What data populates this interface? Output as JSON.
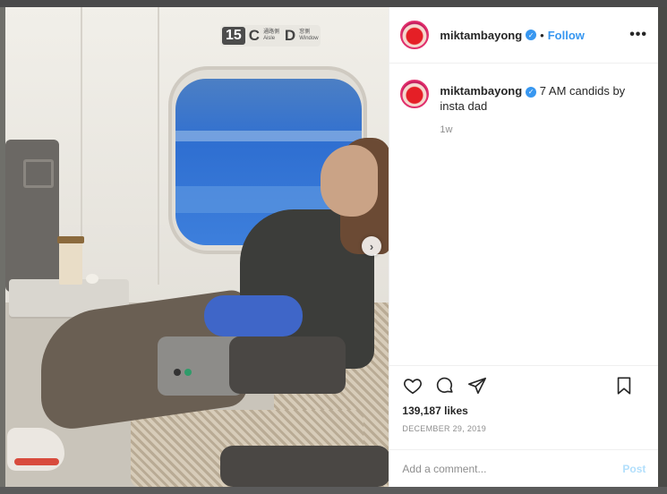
{
  "post": {
    "username": "miktambayong",
    "follow_label": "Follow",
    "more_label": "•••",
    "caption_text": "7 AM candids by insta dad",
    "time_ago": "1w",
    "likes": "139,187 likes",
    "date": "DECEMBER 29, 2019",
    "comment_placeholder": "Add a comment...",
    "post_label": "Post",
    "separator": "•",
    "verified_glyph": "✓"
  },
  "photo": {
    "seat_number": "15",
    "seat_left_letter": "C",
    "seat_left_text": "通路側 Aisle",
    "seat_right_letter": "D",
    "seat_right_text": "窓側 Window",
    "next_glyph": "›"
  },
  "icons": {
    "like": "heart-icon",
    "comment": "comment-icon",
    "share": "share-icon",
    "save": "bookmark-icon",
    "next": "chevron-right-icon",
    "verified": "verified-badge-icon"
  },
  "colors": {
    "link_blue": "#3897f0",
    "post_disabled": "#b2dffc",
    "meta_gray": "#8e8e8e",
    "text": "#262626"
  }
}
